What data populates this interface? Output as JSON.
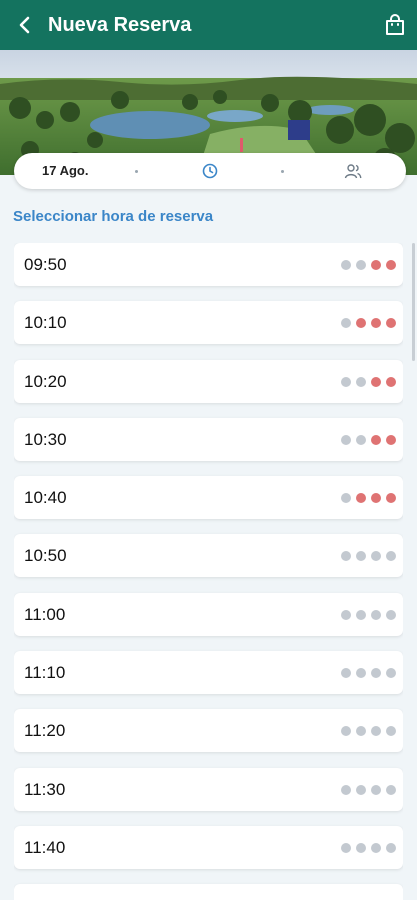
{
  "header": {
    "title": "Nueva Reserva",
    "back_icon": "chevron-left-icon",
    "bag_icon": "shopping-bag-icon",
    "bar_color": "#14735f"
  },
  "stepper": {
    "date": "17 Ago.",
    "time_icon": "clock-icon",
    "players_icon": "people-icon",
    "accent": "#3b86c8"
  },
  "section": {
    "title": "Seleccionar hora de reserva"
  },
  "colors": {
    "free": "#c3c9d0",
    "taken": "#df7373"
  },
  "slots": [
    {
      "time": "09:50",
      "spots": [
        "free",
        "free",
        "taken",
        "taken"
      ]
    },
    {
      "time": "10:10",
      "spots": [
        "free",
        "taken",
        "taken",
        "taken"
      ]
    },
    {
      "time": "10:20",
      "spots": [
        "free",
        "free",
        "taken",
        "taken"
      ]
    },
    {
      "time": "10:30",
      "spots": [
        "free",
        "free",
        "taken",
        "taken"
      ]
    },
    {
      "time": "10:40",
      "spots": [
        "free",
        "taken",
        "taken",
        "taken"
      ]
    },
    {
      "time": "10:50",
      "spots": [
        "free",
        "free",
        "free",
        "free"
      ]
    },
    {
      "time": "11:00",
      "spots": [
        "free",
        "free",
        "free",
        "free"
      ]
    },
    {
      "time": "11:10",
      "spots": [
        "free",
        "free",
        "free",
        "free"
      ]
    },
    {
      "time": "11:20",
      "spots": [
        "free",
        "free",
        "free",
        "free"
      ]
    },
    {
      "time": "11:30",
      "spots": [
        "free",
        "free",
        "free",
        "free"
      ]
    },
    {
      "time": "11:40",
      "spots": [
        "free",
        "free",
        "free",
        "free"
      ]
    },
    {
      "time": "",
      "spots": []
    }
  ]
}
